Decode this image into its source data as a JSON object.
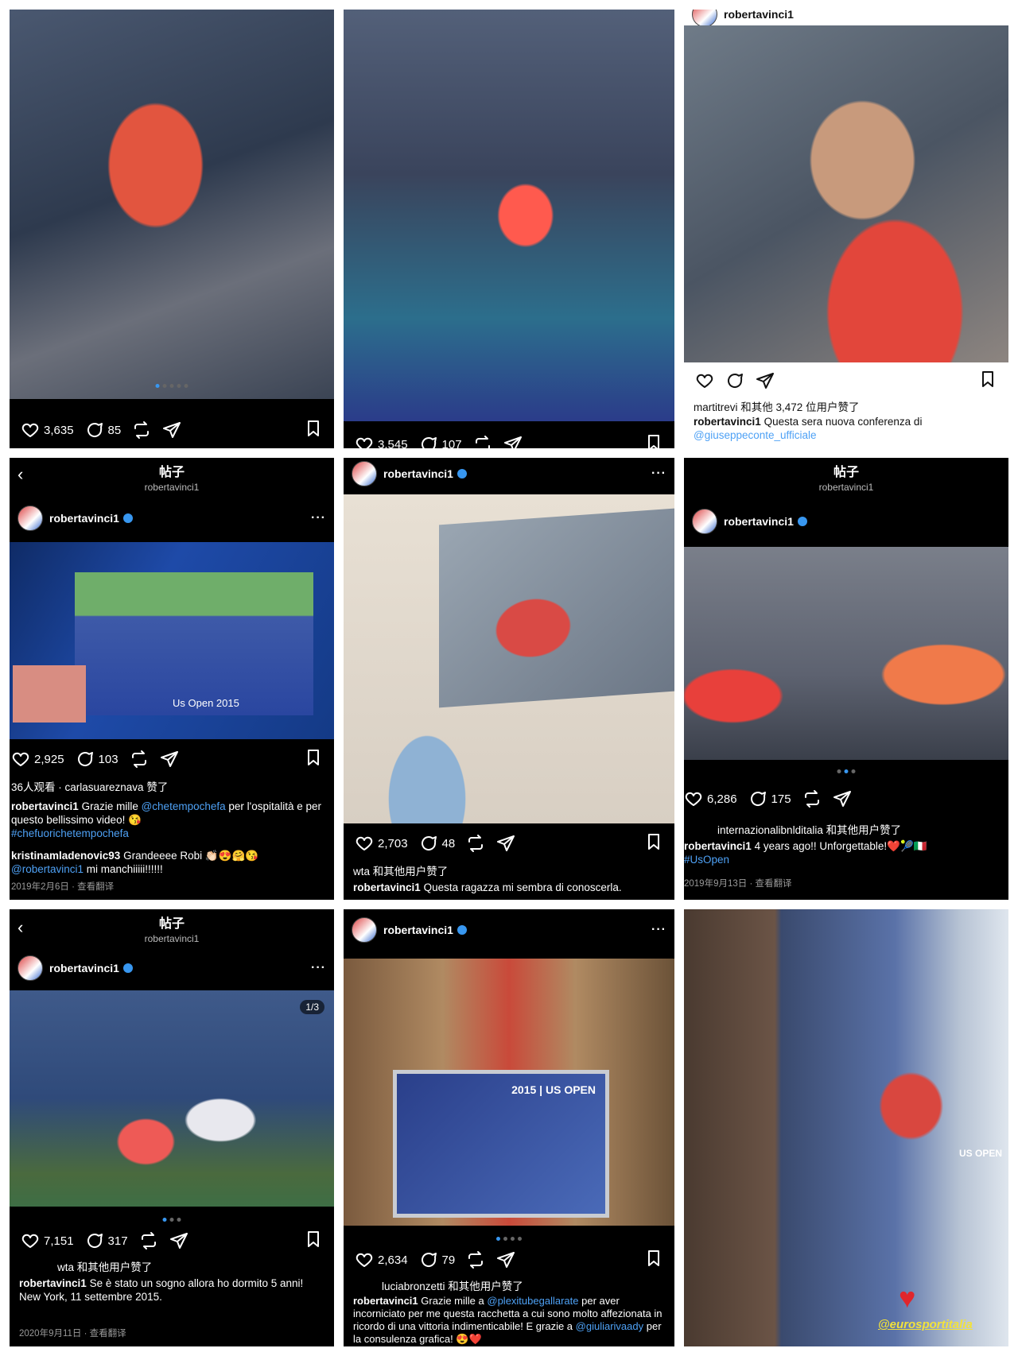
{
  "posts": [
    {
      "likes": "3,635",
      "comments": "85"
    },
    {
      "likes": "3,545",
      "comments": "107"
    },
    {
      "account": "robertavinci1",
      "liked_by": "martitrevi 和其他 3,472 位用户赞了",
      "caption_user": "robertavinci1",
      "caption_text": "Questa sera nuova conferenza di",
      "caption_link": "@giuseppeconte_ufficiale"
    },
    {
      "header_title": "帖子",
      "header_sub": "robertavinci1",
      "username": "robertavinci1",
      "video_overlay": "Us Open 2015",
      "likes": "2,925",
      "comments": "103",
      "viewers": "36人观看 · carlasuareznava 赞了",
      "caption_user": "robertavinci1",
      "caption_text": "Grazie mille",
      "caption_link": "@chetempochefa",
      "caption_rest": "per l'ospitalità e per questo bellissimo video! 😘",
      "hashtag": "#chefuorichetempochefa",
      "comment_user": "kristinamladenovic93",
      "comment_text": "Grandeeee Robi 👏🏻😍🤗😘",
      "comment_link": "@robertavinci1",
      "comment_rest": "mi manchiiiii!!!!!!",
      "date": "2019年2月6日",
      "translate": "查看翻译"
    },
    {
      "username": "robertavinci1",
      "likes": "2,703",
      "comments": "48",
      "liked_by": "wta 和其他用户赞了",
      "caption_user": "robertavinci1",
      "caption_text": "Questa ragazza mi sembra di conoscerla."
    },
    {
      "header_title": "帖子",
      "header_sub": "robertavinci1",
      "username": "robertavinci1",
      "likes": "6,286",
      "comments": "175",
      "liked_by": "internazionalibnlditalia 和其他用户赞了",
      "caption_user": "robertavinci1",
      "caption_text": "4 years ago!! Unforgettable!❤️🎾🇮🇹",
      "hashtag": "#UsOpen",
      "date": "2019年9月13日",
      "translate": "查看翻译"
    },
    {
      "header_title": "帖子",
      "header_sub": "robertavinci1",
      "username": "robertavinci1",
      "page_counter": "1/3",
      "likes": "7,151",
      "comments": "317",
      "liked_by": "wta 和其他用户赞了",
      "caption_user": "robertavinci1",
      "caption_text": "Se è stato un sogno allora ho dormito 5 anni!",
      "caption_line2": "New York, 11 settembre 2015.",
      "date": "2020年9月11日",
      "translate": "查看翻译"
    },
    {
      "username": "robertavinci1",
      "frame_text": "2015 | US OPEN",
      "likes": "2,634",
      "comments": "79",
      "liked_by": "luciabronzetti 和其他用户赞了",
      "caption_user": "robertavinci1",
      "caption_text": "Grazie mille a",
      "caption_link": "@plexitubegallarate",
      "caption_rest": "per aver incorniciato per me questa racchetta a cui sono molto affezionata in ricordo di una vittoria indimenticabile! E grazie a",
      "caption_link2": "@giuliarivaady",
      "caption_rest2": "per la consulenza grafica! 😍❤️"
    },
    {
      "sticker": "@eurosportitalia",
      "sticker_brand": "US OPEN"
    }
  ]
}
